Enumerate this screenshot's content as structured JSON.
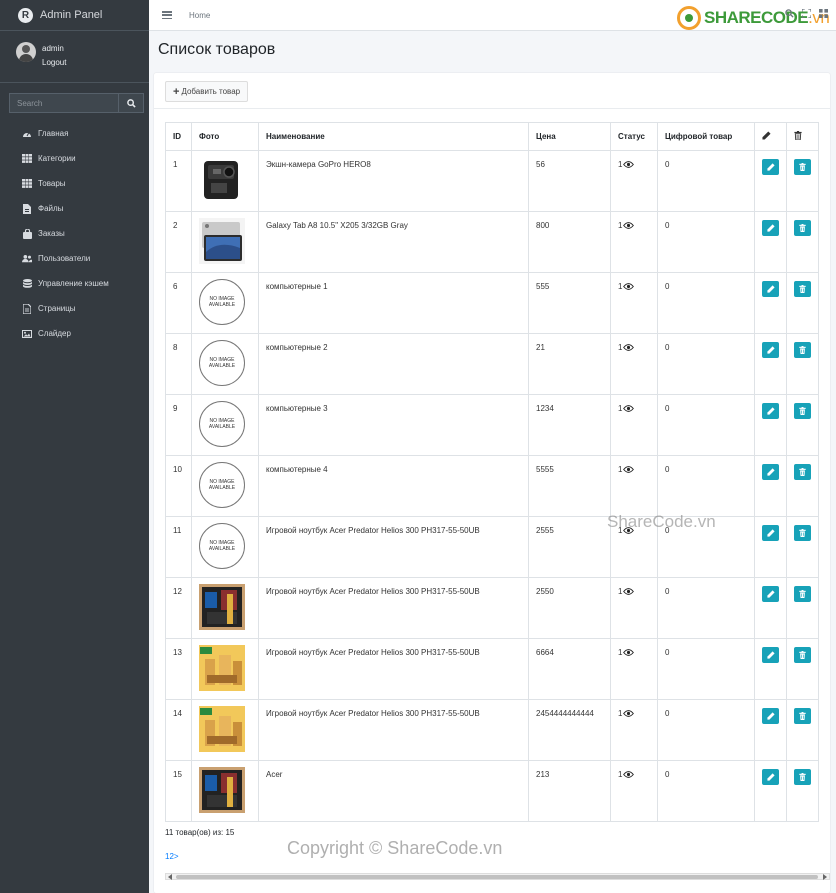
{
  "sidebar": {
    "brand": "Admin Panel",
    "user": {
      "name": "admin",
      "logout": "Logout"
    },
    "search_placeholder": "Search",
    "items": [
      {
        "label": "Главная",
        "icon": "dashboard-icon"
      },
      {
        "label": "Категории",
        "icon": "grid-icon"
      },
      {
        "label": "Товары",
        "icon": "grid-icon"
      },
      {
        "label": "Файлы",
        "icon": "file-icon"
      },
      {
        "label": "Заказы",
        "icon": "shopping-bag-icon"
      },
      {
        "label": "Пользователи",
        "icon": "users-icon"
      },
      {
        "label": "Управление кэшем",
        "icon": "database-icon"
      },
      {
        "label": "Страницы",
        "icon": "page-icon"
      },
      {
        "label": "Слайдер",
        "icon": "image-icon"
      }
    ]
  },
  "topbar": {
    "breadcrumb": "Home"
  },
  "watermarks": {
    "logo_main": "SHARECODE",
    "logo_suffix": ".vn",
    "middle": "ShareCode.vn",
    "bottom": "Copyright © ShareCode.vn"
  },
  "page": {
    "title": "Список товаров",
    "add_button": "Добавить товар"
  },
  "table": {
    "headers": {
      "id": "ID",
      "photo": "Фото",
      "name": "Наименование",
      "price": "Цена",
      "status": "Статус",
      "digital": "Цифровой товар"
    },
    "no_image_text": [
      "NO IMAGE",
      "AVAILABLE"
    ],
    "rows": [
      {
        "id": "1",
        "photo": "gopro",
        "name": "Экшн-камера GoPro HERO8",
        "price": "56",
        "status": "1",
        "digital": "0"
      },
      {
        "id": "2",
        "photo": "tablet",
        "name": "Galaxy Tab A8 10.5\" X205 3/32GB Gray",
        "price": "800",
        "status": "1",
        "digital": "0"
      },
      {
        "id": "6",
        "photo": "none",
        "name": "компьютерные 1",
        "price": "555",
        "status": "1",
        "digital": "0"
      },
      {
        "id": "8",
        "photo": "none",
        "name": "компьютерные 2",
        "price": "21",
        "status": "1",
        "digital": "0"
      },
      {
        "id": "9",
        "photo": "none",
        "name": "компьютерные 3",
        "price": "1234",
        "status": "1",
        "digital": "0"
      },
      {
        "id": "10",
        "photo": "none",
        "name": "компьютерные 4",
        "price": "5555",
        "status": "1",
        "digital": "0"
      },
      {
        "id": "11",
        "photo": "none",
        "name": "Игровой ноутбук Acer Predator Helios 300 PH317-55-50UB",
        "price": "2555",
        "status": "1",
        "digital": "0"
      },
      {
        "id": "12",
        "photo": "dark",
        "name": "Игровой ноутбук Acer Predator Helios 300 PH317-55-50UB",
        "price": "2550",
        "status": "1",
        "digital": "0"
      },
      {
        "id": "13",
        "photo": "yellow",
        "name": "Игровой ноутбук Acer Predator Helios 300 PH317-55-50UB",
        "price": "6664",
        "status": "1",
        "digital": "0"
      },
      {
        "id": "14",
        "photo": "yellow",
        "name": "Игровой ноутбук Acer Predator Helios 300 PH317-55-50UB",
        "price": "2454444444444",
        "status": "1",
        "digital": "0"
      },
      {
        "id": "15",
        "photo": "dark",
        "name": "Acer",
        "price": "213",
        "status": "1",
        "digital": "0"
      }
    ]
  },
  "summary": "11 товар(ов) из: 15",
  "pagination": "12>"
}
